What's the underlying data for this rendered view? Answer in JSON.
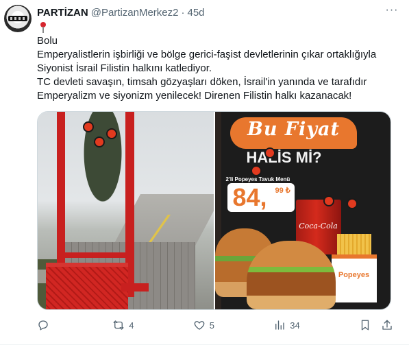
{
  "post": {
    "author_name": "PARTİZAN",
    "author_handle": "@PartizanMerkez2",
    "separator": "·",
    "time": "45d",
    "more": "···",
    "text_lines": [
      "Bolu",
      "Emperyalistlerin işbirliği ve bölge gerici-faşist devletlerinin çıkar ortaklığıyla",
      "Siyonist İsrail Filistin halkını katlediyor.",
      "TC devleti savaşın, timsah gözyaşları döken, İsrail'in yanında ve tarafıdır",
      "Emperyalizm ve siyonizm yenilecek! Direnen Filistin halkı kazanacak!"
    ]
  },
  "media": {
    "ad_banner": "Bu Fiyat",
    "ad_question": "HALİS Mİ?",
    "ad_menu": "2'li Popeyes Tavuk Menü",
    "ad_price": "84,",
    "ad_cents": "99 ₺",
    "ad_drink": "Coca-Cola",
    "ad_brand": "Popeyes"
  },
  "actions": {
    "reply_count": "",
    "repost_count": "4",
    "like_count": "5",
    "views_count": "34"
  },
  "icons": {
    "pin": "round-pushpin-icon",
    "reply": "reply-icon",
    "repost": "repost-icon",
    "like": "heart-icon",
    "views": "views-chart-icon",
    "bookmark": "bookmark-icon",
    "share": "share-icon"
  }
}
